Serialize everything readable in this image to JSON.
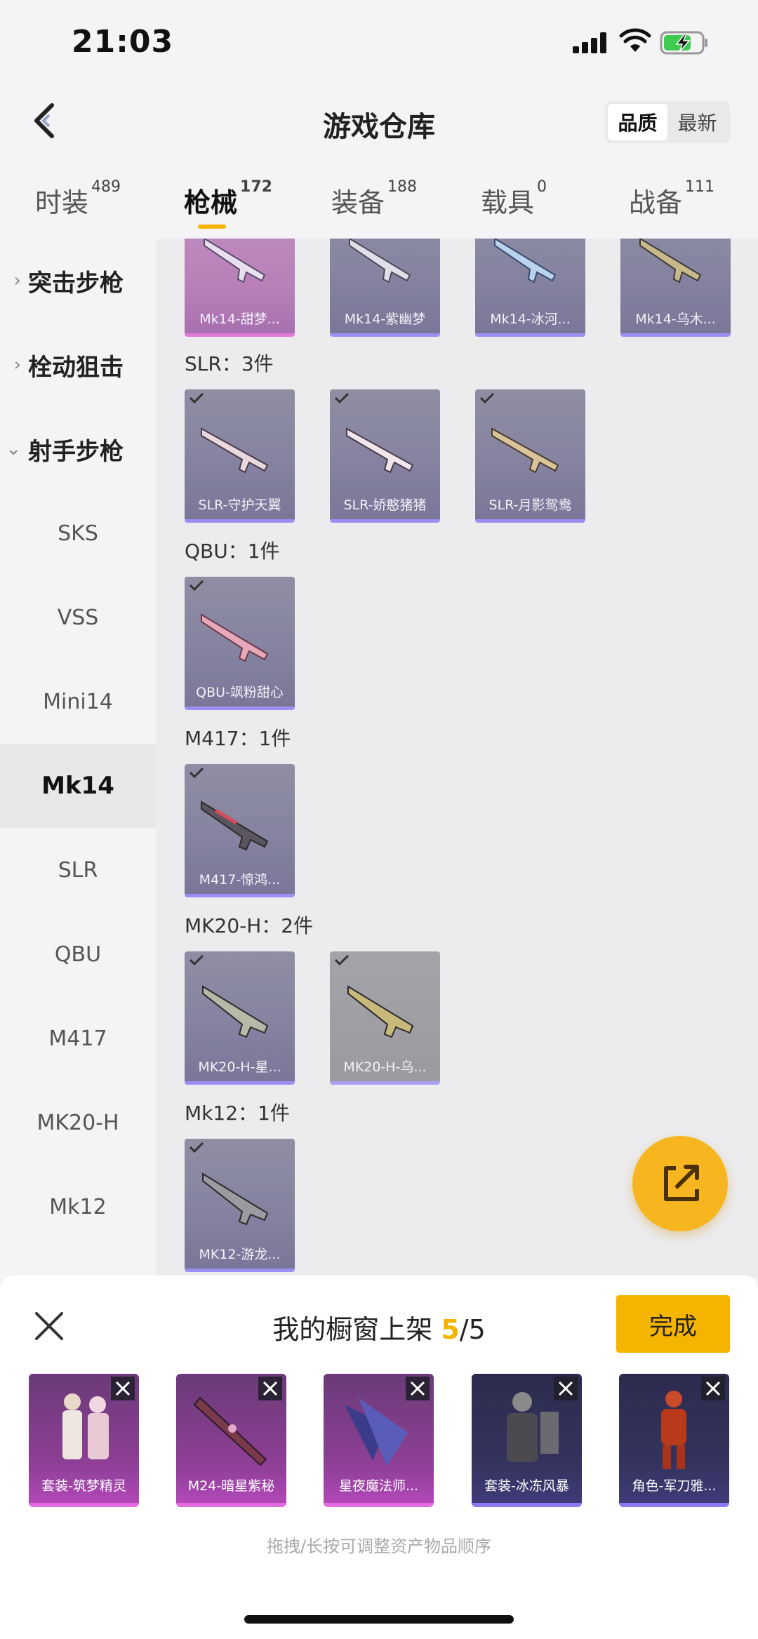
{
  "status": {
    "time": "21:03"
  },
  "nav": {
    "title": "游戏仓库",
    "sort_options": [
      "品质",
      "最新"
    ],
    "active_sort": 0
  },
  "tabs": [
    {
      "label": "时装",
      "count": "489"
    },
    {
      "label": "枪械",
      "count": "172"
    },
    {
      "label": "装备",
      "count": "188"
    },
    {
      "label": "载具",
      "count": "0"
    },
    {
      "label": "战备",
      "count": "111"
    }
  ],
  "sidebar": {
    "groups": [
      {
        "label": "突击步枪",
        "expanded": false
      },
      {
        "label": "栓动狙击",
        "expanded": false
      },
      {
        "label": "射手步枪",
        "expanded": true
      }
    ],
    "items": [
      "SKS",
      "VSS",
      "Mini14",
      "Mk14",
      "SLR",
      "QBU",
      "M417",
      "MK20-H",
      "Mk12"
    ],
    "active_item": "Mk14"
  },
  "content": {
    "top_row": [
      "Mk14-甜梦...",
      "Mk14-紫幽梦",
      "Mk14-冰河...",
      "Mk14-乌木..."
    ],
    "sections": [
      {
        "title": "SLR：3件",
        "items": [
          "SLR-守护天翼",
          "SLR-娇憨猪猪",
          "SLR-月影鸳鸯"
        ]
      },
      {
        "title": "QBU：1件",
        "items": [
          "QBU-飒粉甜心"
        ]
      },
      {
        "title": "M417：1件",
        "items": [
          "M417-惊鸿..."
        ]
      },
      {
        "title": "MK20-H：2件",
        "items": [
          "MK20-H-星...",
          "MK20-H-乌..."
        ]
      },
      {
        "title": "Mk12：1件",
        "items": [
          "MK12-游龙..."
        ]
      }
    ]
  },
  "panel": {
    "title_prefix": "我的橱窗上架 ",
    "count_current": "5",
    "count_total": "/5",
    "done_label": "完成",
    "items": [
      "套装-筑梦精灵",
      "M24-暗星紫秘",
      "星夜魔法师...",
      "套装-冰冻风暴",
      "角色-军刀雅..."
    ],
    "hint": "拖拽/长按可调整资产物品顺序"
  },
  "colors": {
    "accent": "#f5b400",
    "fab": "#f7b620"
  }
}
